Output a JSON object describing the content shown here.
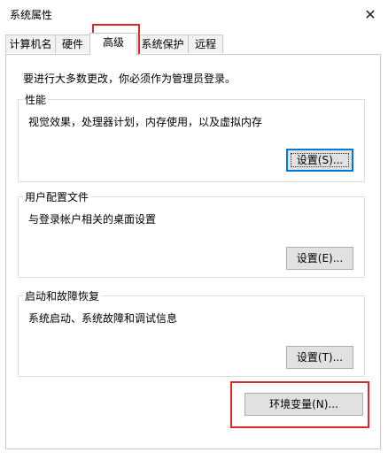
{
  "window": {
    "title": "系统属性",
    "close_icon": "close-icon"
  },
  "tabs": [
    {
      "label": "计算机名",
      "selected": false
    },
    {
      "label": "硬件",
      "selected": false
    },
    {
      "label": "高级",
      "selected": true
    },
    {
      "label": "系统保护",
      "selected": false
    },
    {
      "label": "远程",
      "selected": false
    }
  ],
  "intro": "要进行大多数更改，你必须作为管理员登录。",
  "performance": {
    "title": "性能",
    "description": "视觉效果，处理器计划，内存使用，以及虚拟内存",
    "button": "设置(S)..."
  },
  "user_profiles": {
    "title": "用户配置文件",
    "description": "与登录帐户相关的桌面设置",
    "button": "设置(E)..."
  },
  "startup_recovery": {
    "title": "启动和故障恢复",
    "description": "系统启动、系统故障和调试信息",
    "button": "设置(T)..."
  },
  "env_vars_button": "环境变量(N)...",
  "highlight_color": "#e0262a"
}
